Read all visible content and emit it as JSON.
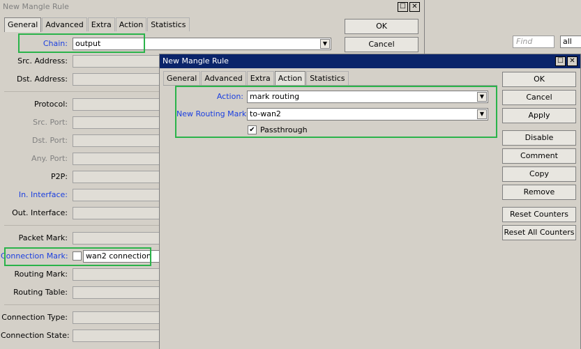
{
  "background_window": {
    "title": "New Mangle Rule",
    "tabs": [
      "General",
      "Advanced",
      "Extra",
      "Action",
      "Statistics"
    ],
    "fields": {
      "chain": {
        "label": "Chain:",
        "value": "output"
      },
      "src_address": {
        "label": "Src. Address:"
      },
      "dst_address": {
        "label": "Dst. Address:"
      },
      "protocol": {
        "label": "Protocol:"
      },
      "src_port": {
        "label": "Src. Port:"
      },
      "dst_port": {
        "label": "Dst. Port:"
      },
      "any_port": {
        "label": "Any. Port:"
      },
      "p2p": {
        "label": "P2P:"
      },
      "in_interface": {
        "label": "In. Interface:"
      },
      "out_interface": {
        "label": "Out. Interface:"
      },
      "packet_mark": {
        "label": "Packet Mark:"
      },
      "connection_mark": {
        "label": "Connection Mark:",
        "value": "wan2 connection"
      },
      "routing_mark": {
        "label": "Routing Mark:"
      },
      "routing_table": {
        "label": "Routing Table:"
      },
      "connection_type": {
        "label": "Connection Type:"
      },
      "connection_state": {
        "label": "Connection State:"
      }
    },
    "buttons": {
      "ok": "OK",
      "cancel": "Cancel"
    },
    "find_placeholder": "Find",
    "filter_value": "all"
  },
  "foreground_window": {
    "title": "New Mangle Rule",
    "tabs": [
      "General",
      "Advanced",
      "Extra",
      "Action",
      "Statistics"
    ],
    "active_tab": "Action",
    "action": {
      "label": "Action:",
      "value": "mark routing"
    },
    "new_routing_mark": {
      "label": "New Routing Mark:",
      "value": "to-wan2"
    },
    "passthrough": {
      "label": "Passthrough",
      "checked": true
    },
    "buttons": {
      "ok": "OK",
      "cancel": "Cancel",
      "apply": "Apply",
      "disable": "Disable",
      "comment": "Comment",
      "copy": "Copy",
      "remove": "Remove",
      "reset_counters": "Reset Counters",
      "reset_all_counters": "Reset All Counters"
    }
  },
  "colors": {
    "highlight": "#2ab34a",
    "link_label": "#1a3ee0",
    "active_title": "#0a246a"
  }
}
